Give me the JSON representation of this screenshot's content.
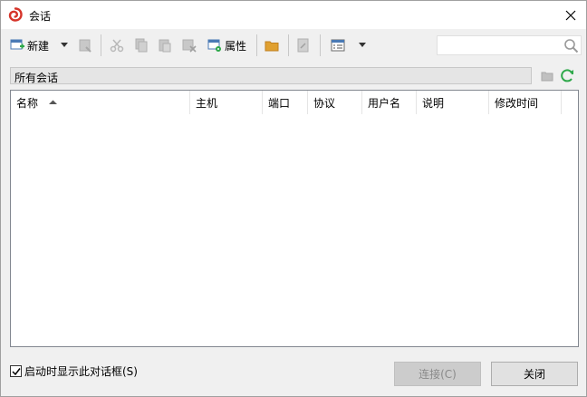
{
  "window": {
    "title": "会话"
  },
  "toolbar": {
    "new_label": "新建",
    "properties_label": "属性",
    "search": {
      "value": "",
      "placeholder": ""
    }
  },
  "path": {
    "current": "所有会话"
  },
  "columns": [
    {
      "label": "名称"
    },
    {
      "label": "主机"
    },
    {
      "label": "端口"
    },
    {
      "label": "协议"
    },
    {
      "label": "用户名"
    },
    {
      "label": "说明"
    },
    {
      "label": "修改时间"
    }
  ],
  "rows": [],
  "footer": {
    "show_on_startup_label": "启动时显示此对话框(S)",
    "show_on_startup_checked": true,
    "connect_label": "连接(C)",
    "close_label": "关闭"
  },
  "colors": {
    "brand": "#d6342a",
    "refresh": "#2ea84a",
    "folder": "#e0a030",
    "disabled_icon": "#b8b8b8"
  }
}
